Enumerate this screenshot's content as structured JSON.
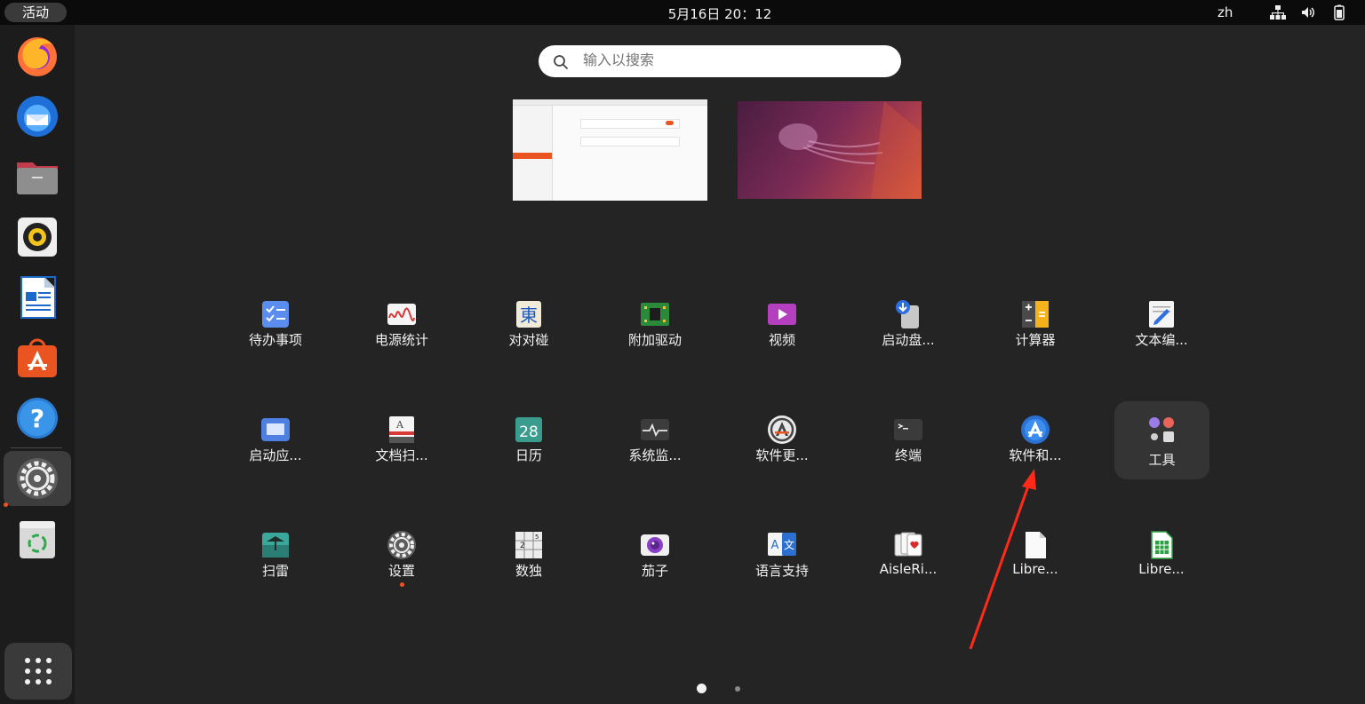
{
  "topbar": {
    "activities": "活动",
    "clock": "5月16日  20：12",
    "language": "zh",
    "tray_icons": [
      "network-icon",
      "volume-icon",
      "battery-icon"
    ]
  },
  "dock": {
    "items": [
      "firefox",
      "thunderbird",
      "files",
      "rhythmbox",
      "libreoffice-writer",
      "ubuntu-software",
      "help",
      "settings",
      "trash"
    ],
    "active": "settings",
    "show_apps": "show-apps-grid-icon"
  },
  "search": {
    "placeholder": "输入以搜索"
  },
  "apps": [
    {
      "label": "待办事项",
      "icon": "todo-icon"
    },
    {
      "label": "电源统计",
      "icon": "power-statistics-icon"
    },
    {
      "label": "对对碰",
      "icon": "mahjongg-icon"
    },
    {
      "label": "附加驱动",
      "icon": "additional-drivers-icon"
    },
    {
      "label": "视频",
      "icon": "videos-icon"
    },
    {
      "label": "启动盘...",
      "icon": "startup-disk-creator-icon"
    },
    {
      "label": "计算器",
      "icon": "calculator-icon"
    },
    {
      "label": "文本编...",
      "icon": "text-editor-icon"
    },
    {
      "label": "启动应...",
      "icon": "startup-applications-icon"
    },
    {
      "label": "文档扫...",
      "icon": "document-scanner-icon"
    },
    {
      "label": "日历",
      "icon": "calendar-icon",
      "day": "28"
    },
    {
      "label": "系统监...",
      "icon": "system-monitor-icon"
    },
    {
      "label": "软件更...",
      "icon": "software-updater-icon"
    },
    {
      "label": "终端",
      "icon": "terminal-icon"
    },
    {
      "label": "软件和...",
      "icon": "software-properties-icon"
    },
    {
      "label": "工具",
      "icon": "utilities-folder-icon"
    },
    {
      "label": "扫雷",
      "icon": "mines-icon"
    },
    {
      "label": "设置",
      "icon": "settings-icon",
      "running": true
    },
    {
      "label": "数独",
      "icon": "sudoku-icon"
    },
    {
      "label": "茄子",
      "icon": "cheese-icon"
    },
    {
      "label": "语言支持",
      "icon": "language-support-icon"
    },
    {
      "label": "AisleRi...",
      "icon": "aisleriot-icon"
    },
    {
      "label": "Libre...",
      "icon": "libreoffice-draw-icon"
    },
    {
      "label": "Libre...",
      "icon": "libreoffice-calc-icon"
    }
  ],
  "pager": {
    "pages": 2,
    "current": 1
  },
  "colors": {
    "accent": "#e95420",
    "background": "#242424",
    "topbar": "#0b0b0b",
    "annotation_arrow": "#ff2a1a"
  }
}
